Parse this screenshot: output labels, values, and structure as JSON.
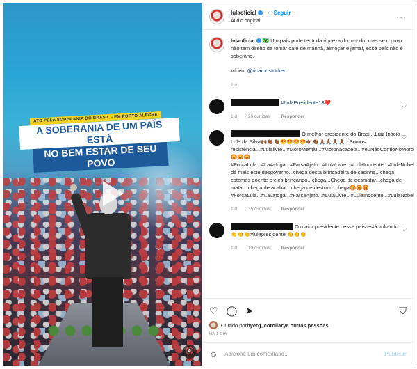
{
  "post": {
    "username": "lulaoficial",
    "separator": "•",
    "follow_label": "Seguir",
    "audio_label": "Áudio original",
    "more_label": "···",
    "video": {
      "tag_text": "ATO PELA SOBERANIA DO BRASIL - EM PORTO ALEGRE",
      "headline_line1": "A SOBERANIA DE UM PAÍS ESTÁ",
      "headline_line2": "NO BEM ESTAR DE SEU POVO",
      "mute_icon": "🔇"
    },
    "caption": {
      "username": "lulaoficial",
      "flag": "🇧🇷",
      "text": "Um país pode ter toda riqueza do mundo, mas se o povo não tem direito de tomar café de manhã, almoçar e jantar, esse país não é soberano.",
      "credit_prefix": "Vídeo: ",
      "credit_mention": "@ricardostuckert",
      "time": "1 d"
    }
  },
  "comments": [
    {
      "text": "#LulaPresidente13❤️",
      "time": "1 d",
      "likes": "26 curtidas",
      "reply": "Responder"
    },
    {
      "text": "O melhor presidente do Brasil...Luiz Inácio Lula da Silva🙌🏾👏🏾👏🏾😍😍😍😍👉🏾👏🏾🙏🏾🙏🏾🙏🏾🙏🏾...Somos resistência...#Lulalivre...#MoroMentiu...#Moronacadeia...#euNãoConfioNoMoro...😡😡😡#ForçaLula...#Lavatoga...#FarsaAjato...#LulaLivre...#LulaInocente...#LulaNobelDaPaz...Chega...não dá mais este desgoverno...chega desta brincadeira de casinha...chega estamos doente e eles brincando...chega...Chega de desmatar...chega de matar...chega de acabar...chega de destruir...chega😡😡😡#ForçaLula...#Lavatoga...#FarsaAjato...#LulaLivre...#LulaInocente...#LulaNobelDaPaz...",
      "time": "1 d",
      "likes": "35 curtidas",
      "reply": "Responder"
    },
    {
      "text": "O maior presidente desse país está voltando 👏👏👏#lulapresidente 👏👏👏",
      "time": "1 d",
      "likes": "19 curtidas",
      "reply": "Responder"
    }
  ],
  "actions": {
    "like_icon": "♡",
    "comment_icon": "◯",
    "share_icon": "➤",
    "bookmark_icon": "⛉",
    "liked_by_prefix": "Curtido por ",
    "liked_by_user": "hyerg_corollary",
    "liked_by_suffix": " e outras pessoas",
    "ago": "HÁ 1 DIA"
  },
  "add_comment": {
    "emoji_icon": "☺",
    "placeholder": "Adicione um comentário...",
    "publish_label": "Publicar"
  },
  "heart_icon": "♡"
}
